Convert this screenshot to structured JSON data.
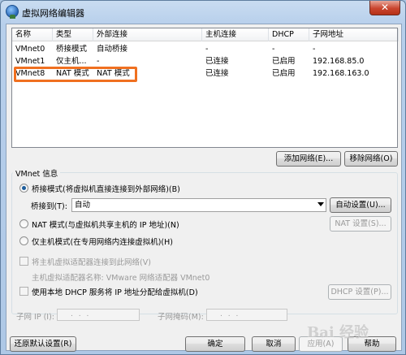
{
  "window": {
    "title": "虚拟网络编辑器",
    "close_label": "✕"
  },
  "table": {
    "headers": [
      "名称",
      "类型",
      "外部连接",
      "主机连接",
      "DHCP",
      "子网地址"
    ],
    "rows": [
      [
        "VMnet0",
        "桥接模式",
        "自动桥接",
        "-",
        "-",
        "-"
      ],
      [
        "VMnet1",
        "仅主机...",
        "-",
        "已连接",
        "已启用",
        "192.168.85.0"
      ],
      [
        "VMnet8",
        "NAT 模式",
        "NAT 模式",
        "已连接",
        "已启用",
        "192.168.163.0"
      ]
    ],
    "highlight_color": "#f07020"
  },
  "buttons": {
    "add_network": "添加网络(E)...",
    "remove_network": "移除网络(O)",
    "auto_settings": "自动设置(U)...",
    "nat_settings": "NAT 设置(S)...",
    "dhcp_settings": "DHCP 设置(P)...",
    "restore_defaults": "还原默认设置(R)",
    "ok": "确定",
    "cancel": "取消",
    "apply": "应用(A)",
    "help": "帮助"
  },
  "vmnet_info": {
    "group_label": "VMnet 信息",
    "bridged_label": "桥接模式(将虚拟机直接连接到外部网络)(B)",
    "bridged_to_label": "桥接到(T):",
    "bridged_to_value": "自动",
    "nat_label": "NAT 模式(与虚拟机共享主机的 IP 地址)(N)",
    "hostonly_label": "仅主机模式(在专用网络内连接虚拟机)(H)",
    "connect_adapter_label": "将主机虚拟适配器连接到此网络(V)",
    "adapter_name_label": "主机虚拟适配器名称: VMware 网络适配器 VMnet0",
    "use_dhcp_label": "使用本地 DHCP 服务将 IP 地址分配给虚拟机(D)",
    "subnet_ip_label": "子网 IP (I):",
    "subnet_mask_label": "子网掩码(M):",
    "ip_placeholder": ".     .     .",
    "mode": "bridged"
  },
  "watermark": "Bai 经验"
}
